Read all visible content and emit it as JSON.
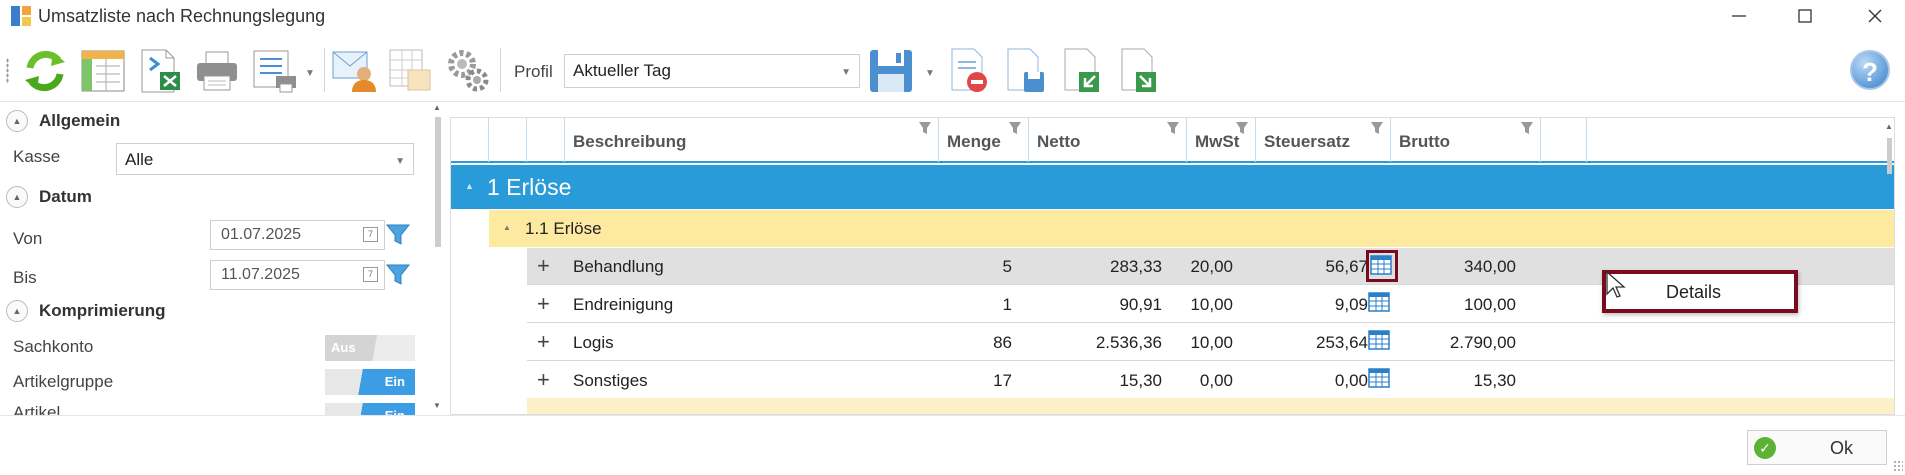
{
  "window": {
    "title": "Umsatzliste nach Rechnungslegung",
    "minimize_glyph": "—",
    "maximize_glyph": "☐",
    "close_glyph": "✕"
  },
  "toolbar": {
    "profil_label": "Profil",
    "profil_value": "Aktueller Tag",
    "help_glyph": "?",
    "icons": [
      "refresh-icon",
      "layout-icon",
      "excel-export-icon",
      "print-icon",
      "print-list-icon",
      "email-icon",
      "table-icon",
      "settings-icon",
      "save-icon",
      "delete-document-icon",
      "save-document-icon",
      "import-document-icon",
      "export-document-icon",
      "help-icon"
    ]
  },
  "left_panel": {
    "allgemein": {
      "title": "Allgemein",
      "kasse_label": "Kasse",
      "kasse_value": "Alle"
    },
    "datum": {
      "title": "Datum",
      "von_label": "Von",
      "von_value": "01.07.2025",
      "bis_label": "Bis",
      "bis_value": "11.07.2025",
      "cal_glyph": "7"
    },
    "komprimierung": {
      "title": "Komprimierung",
      "items": [
        {
          "label": "Sachkonto",
          "state": "Aus"
        },
        {
          "label": "Artikelgruppe",
          "state": "Ein"
        },
        {
          "label": "Artikel",
          "state": "Ein"
        }
      ]
    }
  },
  "grid": {
    "columns": [
      "Beschreibung",
      "Menge",
      "Netto",
      "MwSt",
      "Steuersatz",
      "Brutto"
    ],
    "group_level1": "1 Erlöse",
    "group_level2": "1.1 Erlöse",
    "rows": [
      {
        "beschreibung": "Behandlung",
        "menge": "5",
        "netto": "283,33",
        "mwst": "20,00",
        "steuersatz": "56,67",
        "brutto": "340,00",
        "highlighted": true
      },
      {
        "beschreibung": "Endreinigung",
        "menge": "1",
        "netto": "90,91",
        "mwst": "10,00",
        "steuersatz": "9,09",
        "brutto": "100,00",
        "highlighted": false
      },
      {
        "beschreibung": "Logis",
        "menge": "86",
        "netto": "2.536,36",
        "mwst": "10,00",
        "steuersatz": "253,64",
        "brutto": "2.790,00",
        "highlighted": false
      },
      {
        "beschreibung": "Sonstiges",
        "menge": "17",
        "netto": "15,30",
        "mwst": "0,00",
        "steuersatz": "0,00",
        "brutto": "15,30",
        "highlighted": false
      }
    ],
    "expand_glyph": "+"
  },
  "context_menu": {
    "item": "Details"
  },
  "footer": {
    "ok_label": "Ok",
    "ok_check_glyph": "✓"
  },
  "colors": {
    "accent_blue": "#2a9bd9",
    "group_yellow": "#fde99f",
    "highlight_border": "#7a0b1f",
    "toggle_on": "#3c9de4"
  }
}
